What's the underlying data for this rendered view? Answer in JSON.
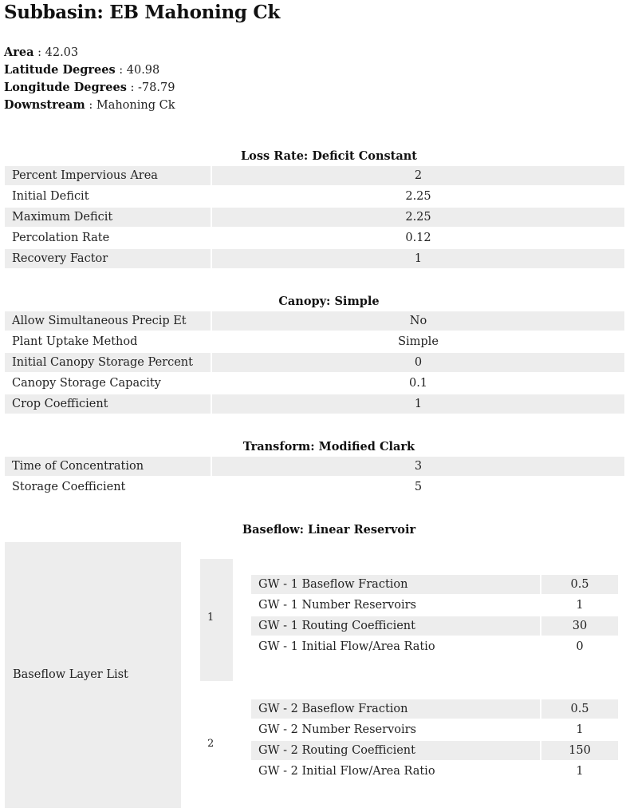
{
  "title": "Subbasin: EB Mahoning Ck",
  "meta": [
    {
      "key": "Area",
      "value": "42.03"
    },
    {
      "key": "Latitude Degrees",
      "value": "40.98"
    },
    {
      "key": "Longitude Degrees",
      "value": "-78.79"
    },
    {
      "key": "Downstream",
      "value": "Mahoning Ck"
    }
  ],
  "separator": " : ",
  "loss_rate": {
    "title": "Loss Rate: Deficit Constant",
    "rows": [
      {
        "label": "Percent Impervious Area",
        "value": "2"
      },
      {
        "label": "Initial Deficit",
        "value": "2.25"
      },
      {
        "label": "Maximum Deficit",
        "value": "2.25"
      },
      {
        "label": "Percolation Rate",
        "value": "0.12"
      },
      {
        "label": "Recovery Factor",
        "value": "1"
      }
    ]
  },
  "canopy": {
    "title": "Canopy: Simple",
    "rows": [
      {
        "label": "Allow Simultaneous Precip Et",
        "value": "No"
      },
      {
        "label": "Plant Uptake Method",
        "value": "Simple"
      },
      {
        "label": "Initial Canopy Storage Percent",
        "value": "0"
      },
      {
        "label": "Canopy Storage Capacity",
        "value": "0.1"
      },
      {
        "label": "Crop Coefficient",
        "value": "1"
      }
    ]
  },
  "transform": {
    "title": "Transform: Modified Clark",
    "rows": [
      {
        "label": "Time of Concentration",
        "value": "3"
      },
      {
        "label": "Storage Coefficient",
        "value": "5"
      }
    ]
  },
  "baseflow": {
    "title": "Baseflow: Linear Reservoir",
    "list_label": "Baseflow Layer List",
    "layers": [
      {
        "id": "1",
        "rows": [
          {
            "label": "GW - 1 Baseflow Fraction",
            "value": "0.5"
          },
          {
            "label": "GW - 1 Number Reservoirs",
            "value": "1"
          },
          {
            "label": "GW - 1 Routing Coefficient",
            "value": "30"
          },
          {
            "label": "GW - 1 Initial Flow/Area Ratio",
            "value": "0"
          }
        ]
      },
      {
        "id": "2",
        "rows": [
          {
            "label": "GW - 2 Baseflow Fraction",
            "value": "0.5"
          },
          {
            "label": "GW - 2 Number Reservoirs",
            "value": "1"
          },
          {
            "label": "GW - 2 Routing Coefficient",
            "value": "150"
          },
          {
            "label": "GW - 2 Initial Flow/Area Ratio",
            "value": "1"
          }
        ]
      }
    ]
  }
}
